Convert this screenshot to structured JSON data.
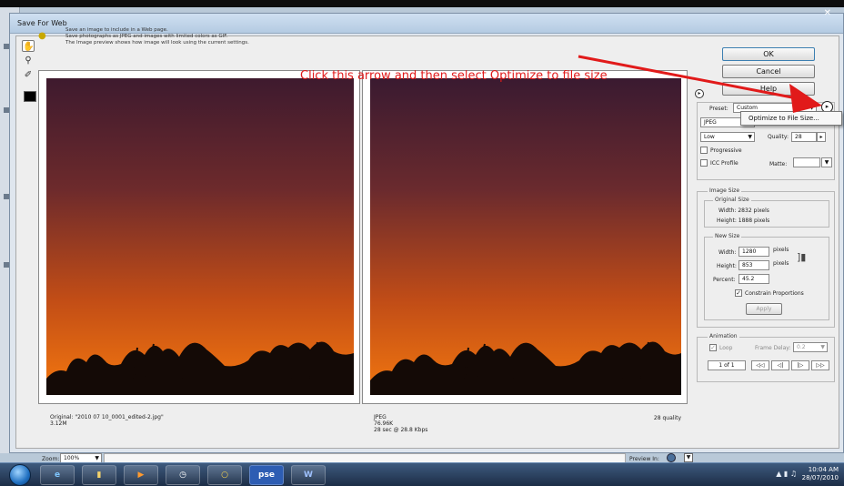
{
  "window": {
    "title": "Save For Web"
  },
  "tip": {
    "lines": [
      "Save an image to include in a Web page.",
      "Save photographs as JPEG and images with limited colors as GIF.",
      "The Image preview shows how image will look using the current settings."
    ]
  },
  "annotation": {
    "text": "Click this arrow and then select Optimize to file size"
  },
  "buttons": {
    "ok": "OK",
    "cancel": "Cancel",
    "help": "Help"
  },
  "settings": {
    "preset_label": "Preset:",
    "preset_value": "Custom",
    "format": "JPEG",
    "quality_level": "Low",
    "quality_label": "Quality:",
    "quality_value": "28",
    "progressive_label": "Progressive",
    "icc_label": "ICC Profile",
    "matte_label": "Matte:"
  },
  "popup": {
    "item": "Optimize to File Size..."
  },
  "image_size": {
    "group_label": "Image Size",
    "original_label": "Original Size",
    "orig_width": "Width: 2832 pixels",
    "orig_height": "Height: 1888 pixels",
    "new_label": "New Size",
    "width_label": "Width:",
    "width_value": "1280",
    "height_label": "Height:",
    "height_value": "853",
    "unit": "pixels",
    "percent_label": "Percent:",
    "percent_value": "45.2",
    "constrain_label": "Constrain Proportions",
    "apply_label": "Apply"
  },
  "animation": {
    "group_label": "Animation",
    "loop_label": "Loop",
    "frame_delay_label": "Frame Delay:",
    "frame_delay_value": "0.2",
    "frame_counter": "1 of 1",
    "nav_labels": [
      "◁◁",
      "◁|",
      "|▷",
      "▷▷"
    ]
  },
  "original_info": {
    "line1": "Original: \"2010 07 10_0001_edited-2.jpg\"",
    "line2": "3.12M"
  },
  "optimized_info": {
    "line1": "JPEG",
    "line2": "76.96K",
    "line3": "28 sec @ 28.8 Kbps",
    "quality": "28 quality"
  },
  "bottom": {
    "zoom_label": "Zoom:",
    "zoom_value": "100%",
    "preview_label": "Preview In:"
  },
  "taskbar": {
    "pse_label": "pse",
    "clock_time": "10:04 AM",
    "clock_date": "28/07/2010"
  },
  "colors": {
    "sky_top": "#3e1a2e",
    "sky_bottom": "#f26f0e",
    "annotation": "#e11a1a"
  }
}
